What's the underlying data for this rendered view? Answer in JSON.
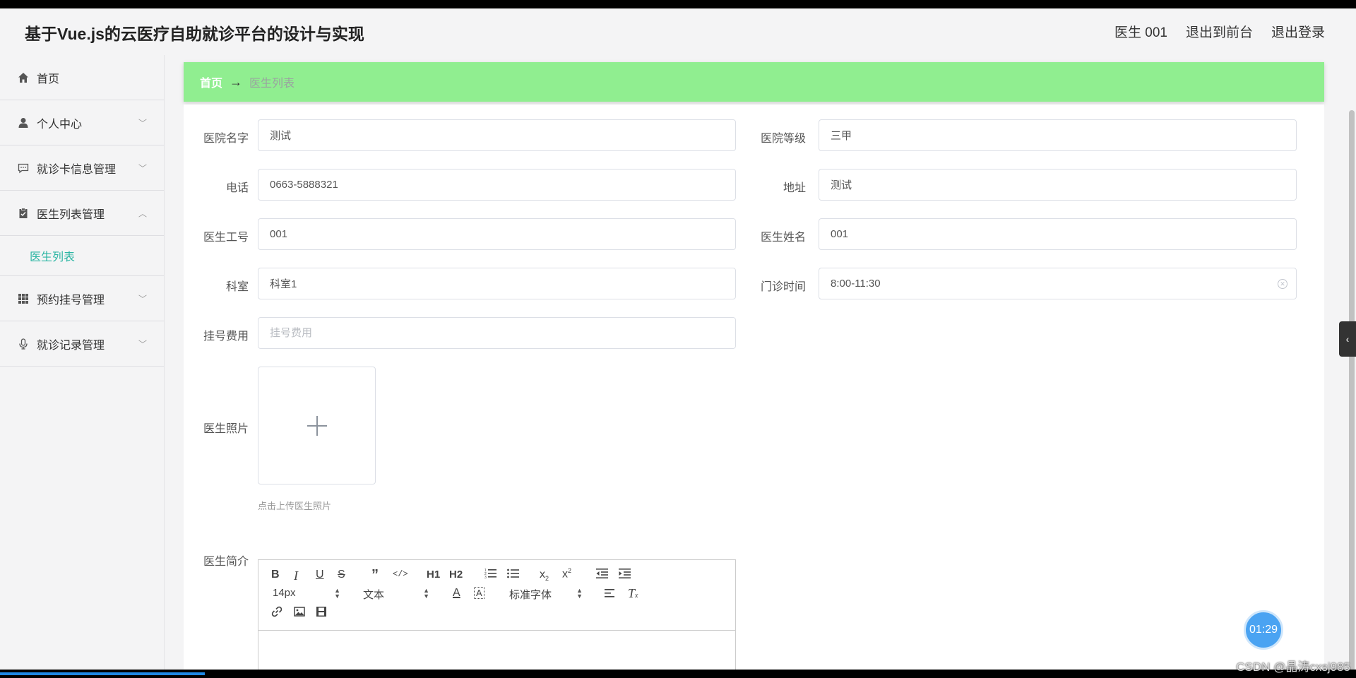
{
  "header": {
    "title": "基于Vue.js的云医疗自助就诊平台的设计与实现",
    "user": "医生 001",
    "to_front": "退出到前台",
    "logout": "退出登录"
  },
  "sidebar": {
    "items": [
      {
        "label": "首页",
        "icon": "home-icon"
      },
      {
        "label": "个人中心",
        "icon": "user-icon"
      },
      {
        "label": "就诊卡信息管理",
        "icon": "chat-icon"
      },
      {
        "label": "医生列表管理",
        "icon": "clipboard-icon"
      },
      {
        "label": "预约挂号管理",
        "icon": "grid-icon"
      },
      {
        "label": "就诊记录管理",
        "icon": "microphone-icon"
      }
    ],
    "submenu": {
      "label": "医生列表"
    }
  },
  "breadcrumb": {
    "home": "首页",
    "arrow": "→",
    "current": "医生列表"
  },
  "form": {
    "hospital_name": {
      "label": "医院名字",
      "value": "测试"
    },
    "hospital_level": {
      "label": "医院等级",
      "value": "三甲"
    },
    "phone": {
      "label": "电话",
      "value": "0663-5888321"
    },
    "address": {
      "label": "地址",
      "value": "测试"
    },
    "doctor_id": {
      "label": "医生工号",
      "value": "001"
    },
    "doctor_name": {
      "label": "医生姓名",
      "value": "001"
    },
    "department": {
      "label": "科室",
      "value": "科室1"
    },
    "clinic_time": {
      "label": "门诊时间",
      "value": "8:00-11:30"
    },
    "fee": {
      "label": "挂号费用",
      "value": "",
      "placeholder": "挂号费用"
    },
    "photo": {
      "label": "医生照片",
      "hint": "点击上传医生照片"
    },
    "intro": {
      "label": "医生简介"
    }
  },
  "editor": {
    "font_size": "14px",
    "block": "文本",
    "font_family": "标准字体",
    "h1": "H1",
    "h2": "H2"
  },
  "timer": "01:29",
  "watermark": "CSDN @晶涛cxsj985"
}
